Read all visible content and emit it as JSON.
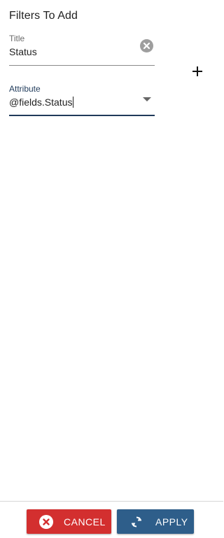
{
  "panel": {
    "title": "Filters To Add"
  },
  "fields": {
    "title": {
      "label": "Title",
      "value": "Status"
    },
    "attribute": {
      "label": "Attribute",
      "value": "@fields.Status"
    }
  },
  "icons": {
    "clear": "close-circle-icon",
    "dropdown": "caret-down-icon",
    "add": "plus-icon",
    "cancel": "close-circle-icon",
    "apply": "refresh-icon"
  },
  "footer": {
    "cancel_label": "CANCEL",
    "apply_label": "APPLY"
  },
  "colors": {
    "cancel": "#d32f2f",
    "apply": "#2e5e8a",
    "focus_underline": "#1f3a5a"
  }
}
